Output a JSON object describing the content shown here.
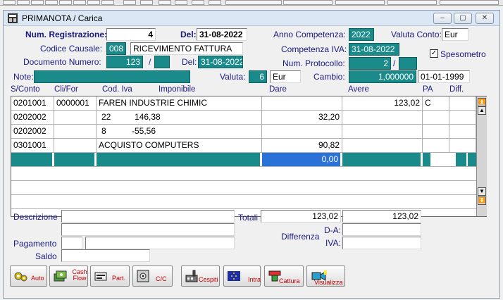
{
  "window": {
    "title": "PRIMANOTA / Carica",
    "minimize": "‒",
    "maximize": "▢",
    "close": "✕"
  },
  "header": {
    "num_reg_label": "Num. Registrazione:",
    "num_reg": "4",
    "del_label": "Del:",
    "del_date": "31-08-2022",
    "anno_comp_label": "Anno Competenza:",
    "anno_comp": "2022",
    "valuta_conto_label": "Valuta Conto:",
    "valuta_conto": "Eur",
    "codice_causale_label": "Codice Causale:",
    "codice_causale": "008",
    "causale_desc": "RICEVIMENTO FATTURA",
    "comp_iva_label": "Competenza IVA:",
    "comp_iva": "31-08-2022",
    "spesometro_label": "Spesometro",
    "spesometro_check": "✓",
    "doc_num_label": "Documento Numero:",
    "doc_num": "123",
    "slash1": "/",
    "del2_label": "Del:",
    "del2_date": "31-08-2022",
    "num_prot_label": "Num. Protocollo:",
    "num_prot": "2",
    "slash2": "/",
    "note_label": "Note:",
    "valuta_label": "Valuta:",
    "valuta_num": "6",
    "valuta": "Eur",
    "cambio_label": "Cambio:",
    "cambio": "1,000000",
    "cambio_date": "01-01-1999"
  },
  "grid": {
    "headers": [
      "S/Conto",
      "Cli/For",
      "Cod. Iva",
      "Imponibile",
      "Dare",
      "Avere",
      "PA",
      "Diff."
    ],
    "rows": [
      {
        "sconto": "0201001",
        "clifor": "0000001",
        "desc": "FAREN INDUSTRIE CHIMIC",
        "dare": "",
        "avere": "123,02",
        "pa": "C"
      },
      {
        "sconto": "0202002",
        "clifor": "",
        "desc": "",
        "codiva": "22",
        "imponibile": "146,38",
        "dare": "32,20",
        "avere": "",
        "pa": ""
      },
      {
        "sconto": "0202002",
        "clifor": "",
        "desc": "",
        "codiva": "8",
        "imponibile": "-55,56",
        "dare": "",
        "avere": "",
        "pa": ""
      },
      {
        "sconto": "0301001",
        "clifor": "",
        "desc": "ACQUISTO COMPUTERS",
        "dare": "90,82",
        "avere": "",
        "pa": ""
      },
      {
        "sconto": "",
        "clifor": "",
        "desc": "",
        "dare": "0,00",
        "avere": "",
        "pa": ""
      }
    ]
  },
  "footer": {
    "descrizione_label": "Descrizione",
    "totali_label": "Totali",
    "tot_dare": "123,02",
    "tot_avere": "123,02",
    "da_label": "D-A:",
    "differenza_label": "Differenza",
    "iva_label": "IVA:",
    "pagamento_label": "Pagamento",
    "saldo_label": "Saldo"
  },
  "toolbar": [
    {
      "label": "Auto",
      "icon": "gears-icon"
    },
    {
      "label": "Cash Flow",
      "icon": "cash-flow-icon"
    },
    {
      "label": "Part.",
      "icon": "partite-icon"
    },
    {
      "label": "C/C",
      "icon": "safe-icon"
    },
    {
      "label": "Cespiti",
      "icon": "factory-icon"
    },
    {
      "label": "Intra",
      "icon": "eu-flag-icon"
    },
    {
      "label": "Cattura",
      "icon": "capture-icon"
    },
    {
      "label": "Visualizza",
      "icon": "camera-icon"
    }
  ]
}
